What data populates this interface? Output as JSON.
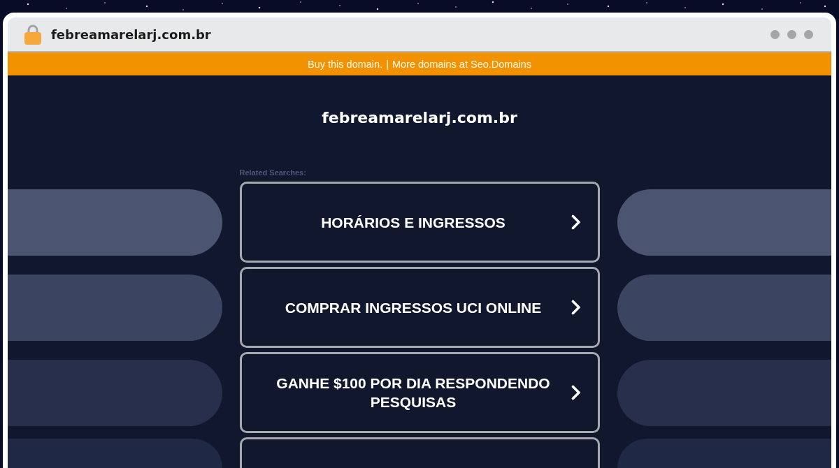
{
  "browser": {
    "url": "febreamarelarj.com.br"
  },
  "banner": {
    "links": [
      "Buy this domain.",
      "More domains at Seo.Domains"
    ],
    "separator": "|"
  },
  "page": {
    "title": "febreamarelarj.com.br",
    "related_label": "Related Searches:",
    "results": [
      {
        "label": "HORÁRIOS E INGRESSOS"
      },
      {
        "label": "COMPRAR INGRESSOS UCI ONLINE"
      },
      {
        "label": "GANHE $100 POR DIA RESPONDENDO PESQUISAS"
      }
    ],
    "cut_off_result": true
  }
}
